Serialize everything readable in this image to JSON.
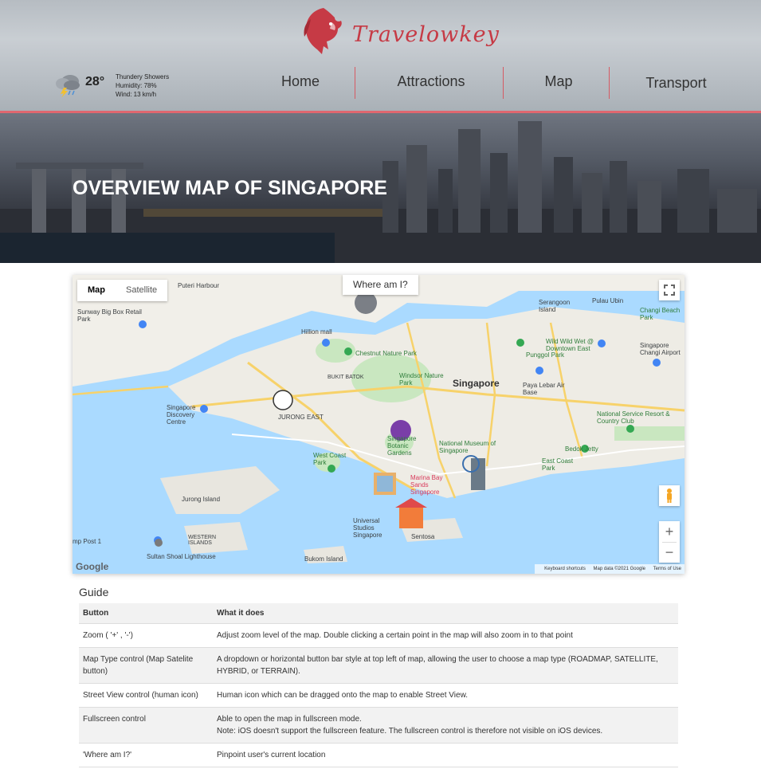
{
  "brand": {
    "name": "Travelowkey",
    "color": "#c63a45"
  },
  "weather": {
    "icon": "thunderstorm-icon",
    "temperature": "28°",
    "condition": "Thundery Showers",
    "humidity": "Humidity: 78%",
    "wind": "Wind: 13 km/h"
  },
  "nav": [
    {
      "label": "Home"
    },
    {
      "label": "Attractions"
    },
    {
      "label": "Map"
    },
    {
      "label": "Transport"
    }
  ],
  "hero": {
    "title": "OVERVIEW MAP OF SINGAPORE"
  },
  "map": {
    "type_controls": {
      "map": "Map",
      "satellite": "Satellite"
    },
    "where_am_i": "Where am I?",
    "zoom_in": "+",
    "zoom_out": "−",
    "google": "Google",
    "footer": {
      "shortcuts": "Keyboard shortcuts",
      "data": "Map data ©2021 Google",
      "terms": "Terms of Use"
    },
    "labels": {
      "singapore": "Singapore",
      "puteri_harbour": "Puteri Harbour",
      "sunway": "Sunway Big Box Retail Park",
      "hillion": "Hillion mall",
      "chestnut": "Chestnut Nature Park",
      "windsor": "Windsor Nature Park",
      "punggol": "Punggol Park",
      "paya_lebar": "Paya Lebar Air Base",
      "wild_wild_wet": "Wild Wild Wet @ Downtown East",
      "changi_beach": "Changi Beach Park",
      "changi_airport": "Singapore Changi Airport",
      "serangoon": "Serangoon Island",
      "pulau_ubin": "Pulau Ubin",
      "discovery": "Singapore Discovery Centre",
      "jurong_east": "JURONG EAST",
      "botanic": "Singapore Botanic Gardens",
      "national_museum": "National Museum of Singapore",
      "west_coast": "West Coast Park",
      "marina": "Marina Bay Sands Singapore",
      "east_coast": "East Coast Park",
      "bedok": "Bedok Jetty",
      "national_service": "National Service Resort & Country Club",
      "jurong_island": "Jurong Island",
      "western_islands": "WESTERN ISLANDS",
      "universal": "Universal Studios Singapore",
      "sentosa": "Sentosa",
      "sultan_shoal": "Sultan Shoal Lighthouse",
      "bukom": "Bukom Island",
      "bukit_batok": "BUKIT BATOK",
      "mp_post": "mp Post 1"
    }
  },
  "guide": {
    "title": "Guide",
    "headers": [
      "Button",
      "What it does"
    ],
    "rows": [
      {
        "button": "Zoom ( '+' , '-')",
        "desc": "Adjust zoom level of the map. Double clicking a certain point in the map will also zoom in to that point"
      },
      {
        "button": "Map Type control (Map Satelite button)",
        "desc": "A dropdown or horizontal button bar style at top left of map, allowing the user to choose a map type (ROADMAP, SATELLITE, HYBRID, or TERRAIN)."
      },
      {
        "button": "Street View control (human icon)",
        "desc": "Human icon which can be dragged onto the map to enable Street View."
      },
      {
        "button": "Fullscreen control",
        "desc": "Able to open the map in fullscreen mode.",
        "desc2": "Note: iOS doesn't support the fullscreen feature. The fullscreen control is therefore not visible on iOS devices."
      },
      {
        "button": "'Where am I?'",
        "desc": "Pinpoint user's current location"
      }
    ]
  }
}
